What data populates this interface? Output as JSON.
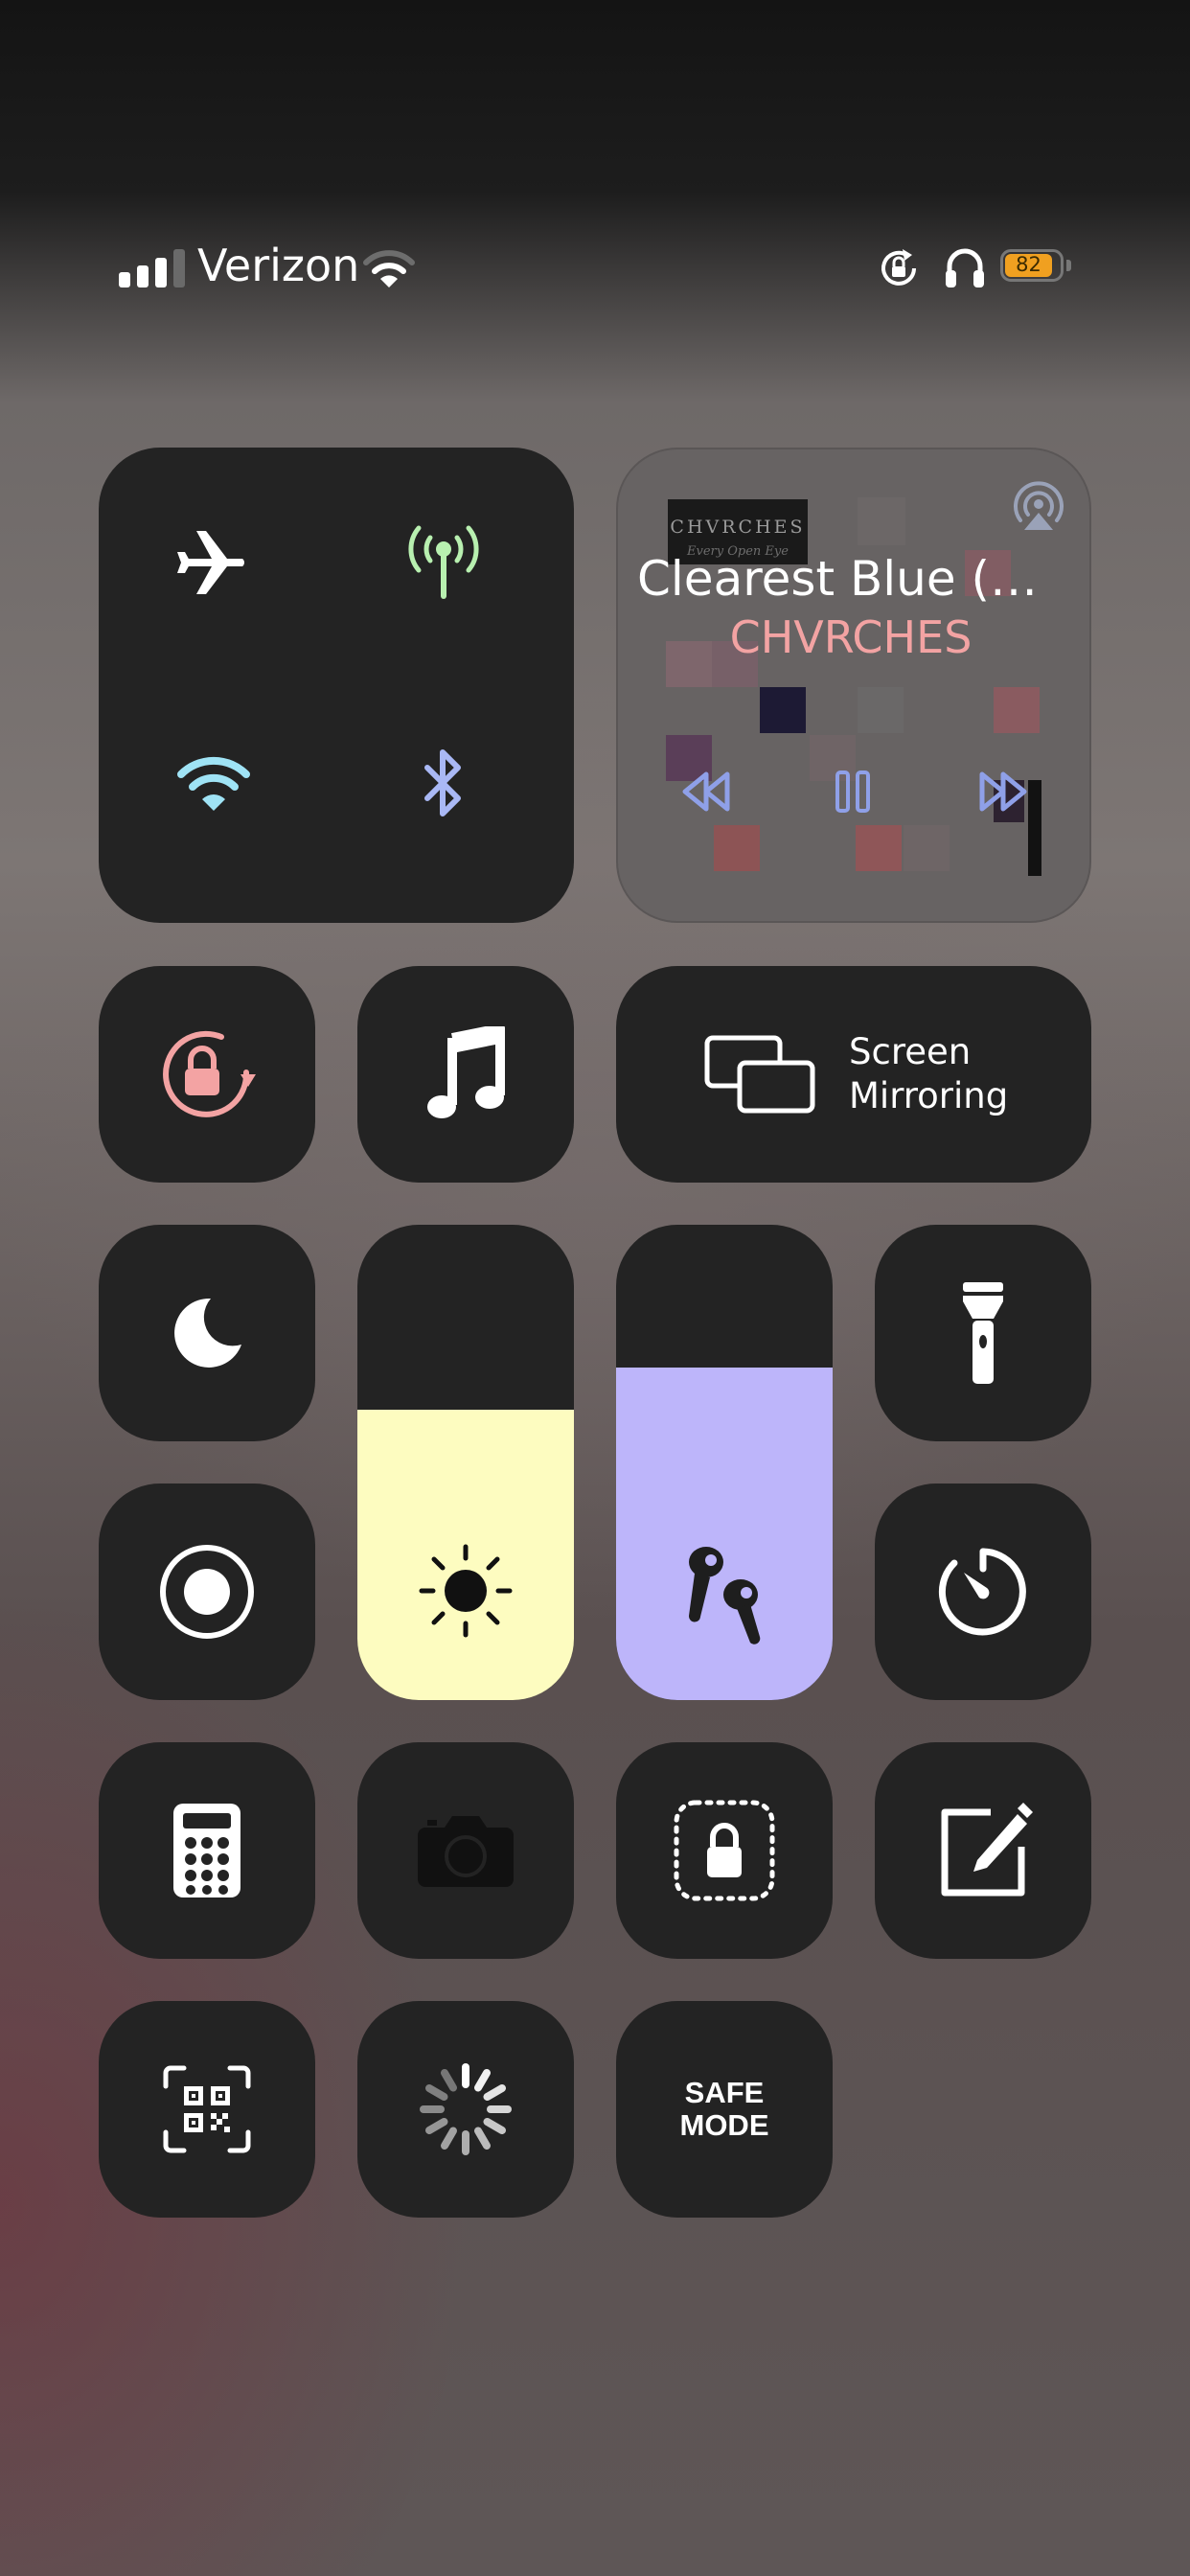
{
  "status_bar": {
    "carrier": "Verizon",
    "battery_percent": "82",
    "battery_color": "#f0a020",
    "icons": [
      "signal-bars-icon",
      "wifi-icon",
      "rotation-lock-icon",
      "headphones-icon",
      "battery-icon"
    ]
  },
  "connectivity": {
    "airplane_mode": false,
    "cellular_data": true,
    "wifi": true,
    "bluetooth": true,
    "colors": {
      "cellular": "#b8f0b0",
      "wifi": "#9fe3f5",
      "bluetooth": "#a9b8f5"
    }
  },
  "now_playing": {
    "title": "Clearest Blue (Gr…",
    "artist": "CHVRCHES",
    "album_text": "CHVRCHES",
    "album_subtitle": "Every Open Eye",
    "controls": [
      "previous-icon",
      "pause-icon",
      "next-icon"
    ],
    "accent_color": "#8fa0e8"
  },
  "screen_mirroring": {
    "label_line1": "Screen",
    "label_line2": "Mirroring"
  },
  "sliders": {
    "brightness_level": 0.61,
    "brightness_color": "#fdfcc0",
    "volume_level": 0.7,
    "volume_color": "#bdb5fa"
  },
  "safe_mode": {
    "line1": "SAFE",
    "line2": "MODE"
  }
}
